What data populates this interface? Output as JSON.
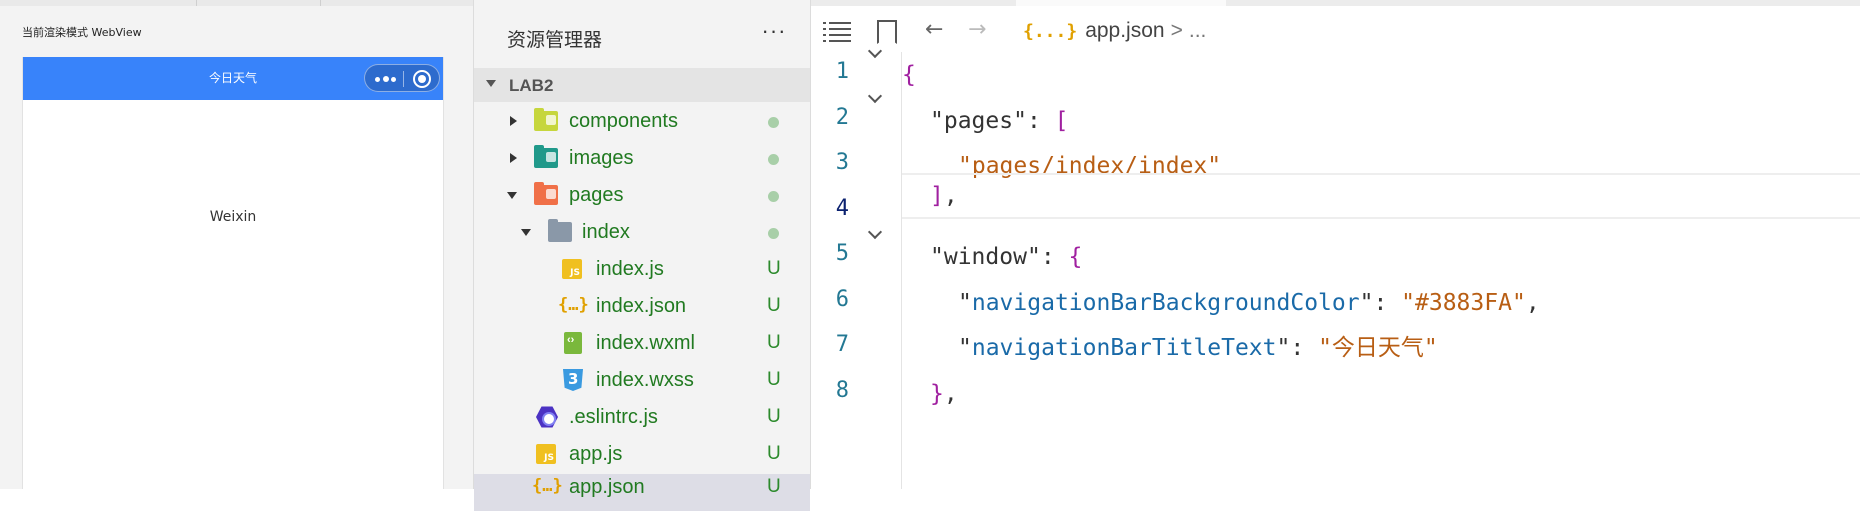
{
  "simulator": {
    "mode_label": "当前渲染模式 WebView",
    "nav_title": "今日天气",
    "nav_color": "#3883FA",
    "page_text": "Weixin"
  },
  "explorer": {
    "title": "资源管理器",
    "more": "···",
    "project": "LAB2",
    "items": [
      {
        "label": "components",
        "status": "●"
      },
      {
        "label": "images",
        "status": "●"
      },
      {
        "label": "pages",
        "status": "●"
      },
      {
        "label": "index",
        "status": "●"
      },
      {
        "label": "index.js",
        "status": "U"
      },
      {
        "label": "index.json",
        "status": "U"
      },
      {
        "label": "index.wxml",
        "status": "U"
      },
      {
        "label": "index.wxss",
        "status": "U"
      },
      {
        "label": ".eslintrc.js",
        "status": "U"
      },
      {
        "label": "app.js",
        "status": "U"
      },
      {
        "label": "app.json",
        "status": "U"
      }
    ]
  },
  "editor": {
    "breadcrumb_icon": "{...}",
    "breadcrumb_file": "app.json",
    "breadcrumb_sep": ">",
    "breadcrumb_rest": "...",
    "line_numbers": [
      "1",
      "2",
      "3",
      "4",
      "5",
      "6",
      "7",
      "8"
    ],
    "code": {
      "l1_open": "{",
      "l2_key": "pages",
      "l2_colon": ": ",
      "l2_open": "[",
      "l3_str": "pages/index/index",
      "l4_close": "]",
      "l4_comma": ",",
      "l5_key": "window",
      "l5_colon": ": ",
      "l5_open": "{",
      "l6_key": "navigationBarBackgroundColor",
      "l6_colon": ": ",
      "l6_val": "#3883FA",
      "l6_comma": ",",
      "l7_key": "navigationBarTitleText",
      "l7_colon": ": ",
      "l7_val": "今日天气",
      "l8_close": "}",
      "l8_comma": ","
    }
  },
  "icons": {
    "list": "list-icon",
    "bookmark": "bookmark-icon",
    "back": "arrow-left-icon",
    "forward": "arrow-right-icon",
    "more": "ellipsis-icon"
  }
}
